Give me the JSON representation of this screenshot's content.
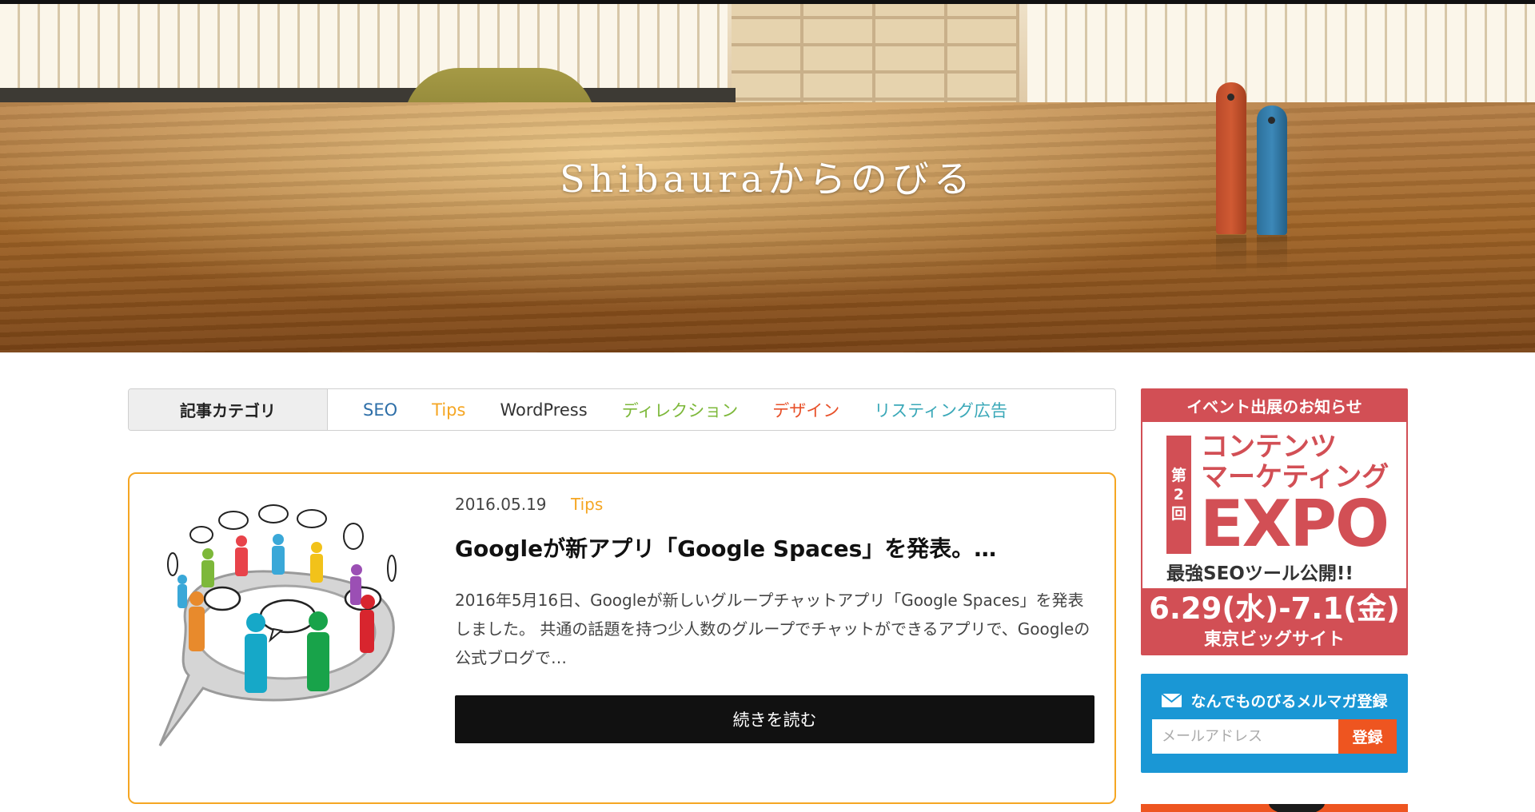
{
  "hero": {
    "site_title": "Shibauraからのびる"
  },
  "categories": {
    "label": "記事カテゴリ",
    "items": [
      {
        "label": "SEO",
        "color": "#2e6fa8"
      },
      {
        "label": "Tips",
        "color": "#f5a623"
      },
      {
        "label": "WordPress",
        "color": "#333333"
      },
      {
        "label": "ディレクション",
        "color": "#7db83a"
      },
      {
        "label": "デザイン",
        "color": "#e8512a"
      },
      {
        "label": "リスティング広告",
        "color": "#3aa8b8"
      }
    ]
  },
  "article": {
    "date": "2016.05.19",
    "tag": "Tips",
    "title": "Googleが新アプリ「Google Spaces」を発表。…",
    "excerpt": "2016年5月16日、Googleが新しいグループチャットアプリ「Google Spaces」を発表しました。 共通の話題を持つ少人数のグループでチャットができるアプリで、Googleの公式ブログで…",
    "read_more_label": "続きを読む",
    "thumbnail_icon": "group-chat-bubble-icon",
    "border_color": "#f5a623"
  },
  "sidebar": {
    "event": {
      "header": "イベント出展のお知らせ",
      "ordinal": [
        "第",
        "2",
        "回"
      ],
      "name_line1": "コンテンツ",
      "name_line2": "マーケティング",
      "expo": "EXPO",
      "tagline": "最強SEOツール公開!!",
      "dates": "6.29(水)-7.1(金)",
      "venue": "東京ビッグサイト",
      "accent": "#d24f55"
    },
    "newsletter": {
      "title": "なんでものびるメルマガ登録",
      "placeholder": "メールアドレス",
      "submit_label": "登録",
      "icon": "mail-icon",
      "bg": "#1a97d5",
      "button_color": "#ee5520"
    }
  }
}
